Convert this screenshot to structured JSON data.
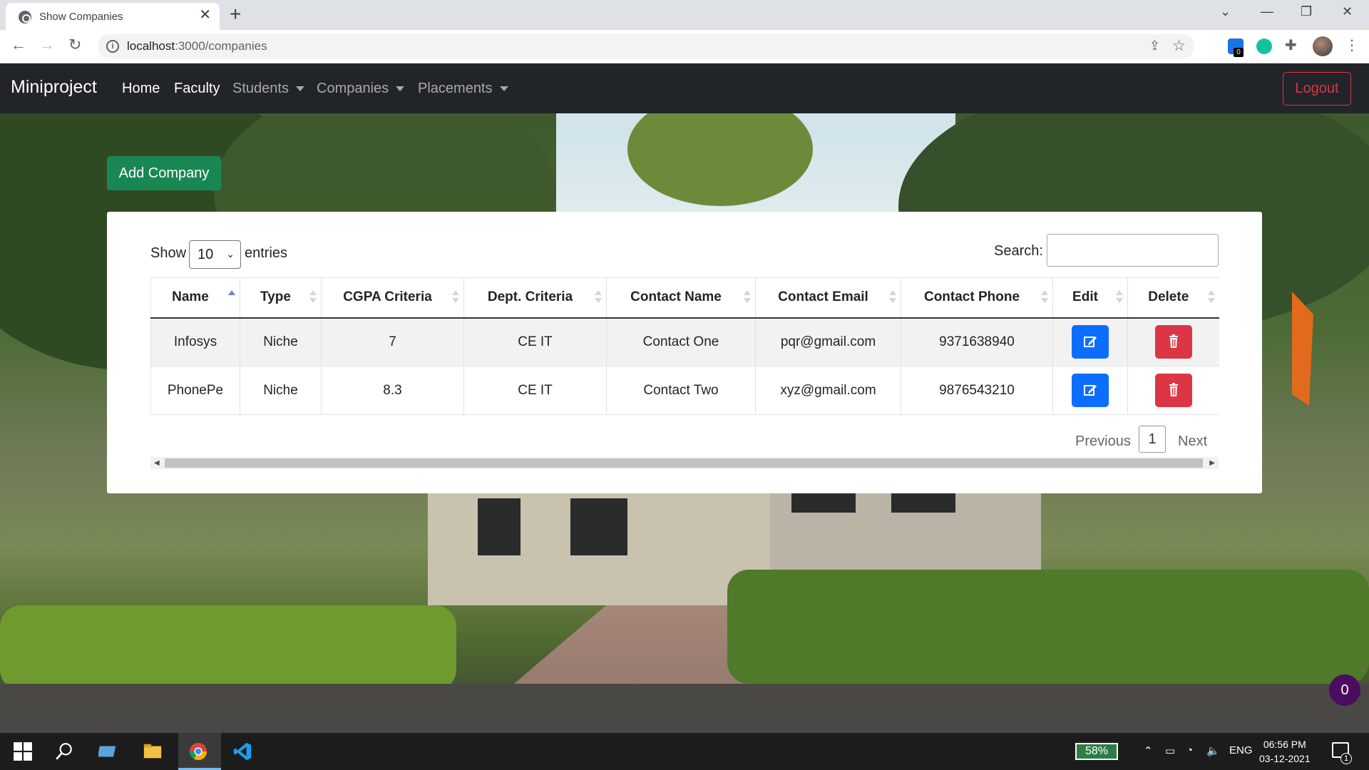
{
  "browser": {
    "tab_title": "Show Companies",
    "tab_close": "✕",
    "new_tab": "+",
    "url_host": "localhost",
    "url_path": ":3000/companies",
    "extension_badge": "0"
  },
  "navbar": {
    "brand": "Miniproject",
    "links": [
      {
        "label": "Home"
      },
      {
        "label": "Faculty"
      },
      {
        "label": "Students"
      },
      {
        "label": "Companies"
      },
      {
        "label": "Placements"
      }
    ],
    "logout_label": "Logout"
  },
  "page": {
    "add_button_label": "Add Company"
  },
  "datatable": {
    "show_label": "Show",
    "entries_label": "entries",
    "page_length": "10",
    "search_label": "Search:",
    "search_value": "",
    "columns": [
      "Name",
      "Type",
      "CGPA Criteria",
      "Dept. Criteria",
      "Contact Name",
      "Contact Email",
      "Contact Phone",
      "Edit",
      "Delete"
    ],
    "sorted_column": "Name",
    "rows": [
      {
        "name": "Infosys",
        "type": "Niche",
        "cgpa": "7",
        "dept": "CE IT",
        "contact_name": "Contact One",
        "contact_email": "pqr@gmail.com",
        "contact_phone": "9371638940"
      },
      {
        "name": "PhonePe",
        "type": "Niche",
        "cgpa": "8.3",
        "dept": "CE IT",
        "contact_name": "Contact Two",
        "contact_email": "xyz@gmail.com",
        "contact_phone": "9876543210"
      }
    ],
    "pagination": {
      "previous": "Previous",
      "current": "1",
      "next": "Next"
    }
  },
  "floating_badge": "0",
  "taskbar": {
    "battery": "58%",
    "language": "ENG",
    "time": "06:56 PM",
    "date": "03-12-2021",
    "notification_count": "1"
  },
  "colors": {
    "navbar_bg": "#212529",
    "add_button": "#198754",
    "edit_button": "#0d6efd",
    "delete_button": "#dc3545",
    "logout": "#dc3545",
    "floating_badge": "#4b0d5f"
  }
}
